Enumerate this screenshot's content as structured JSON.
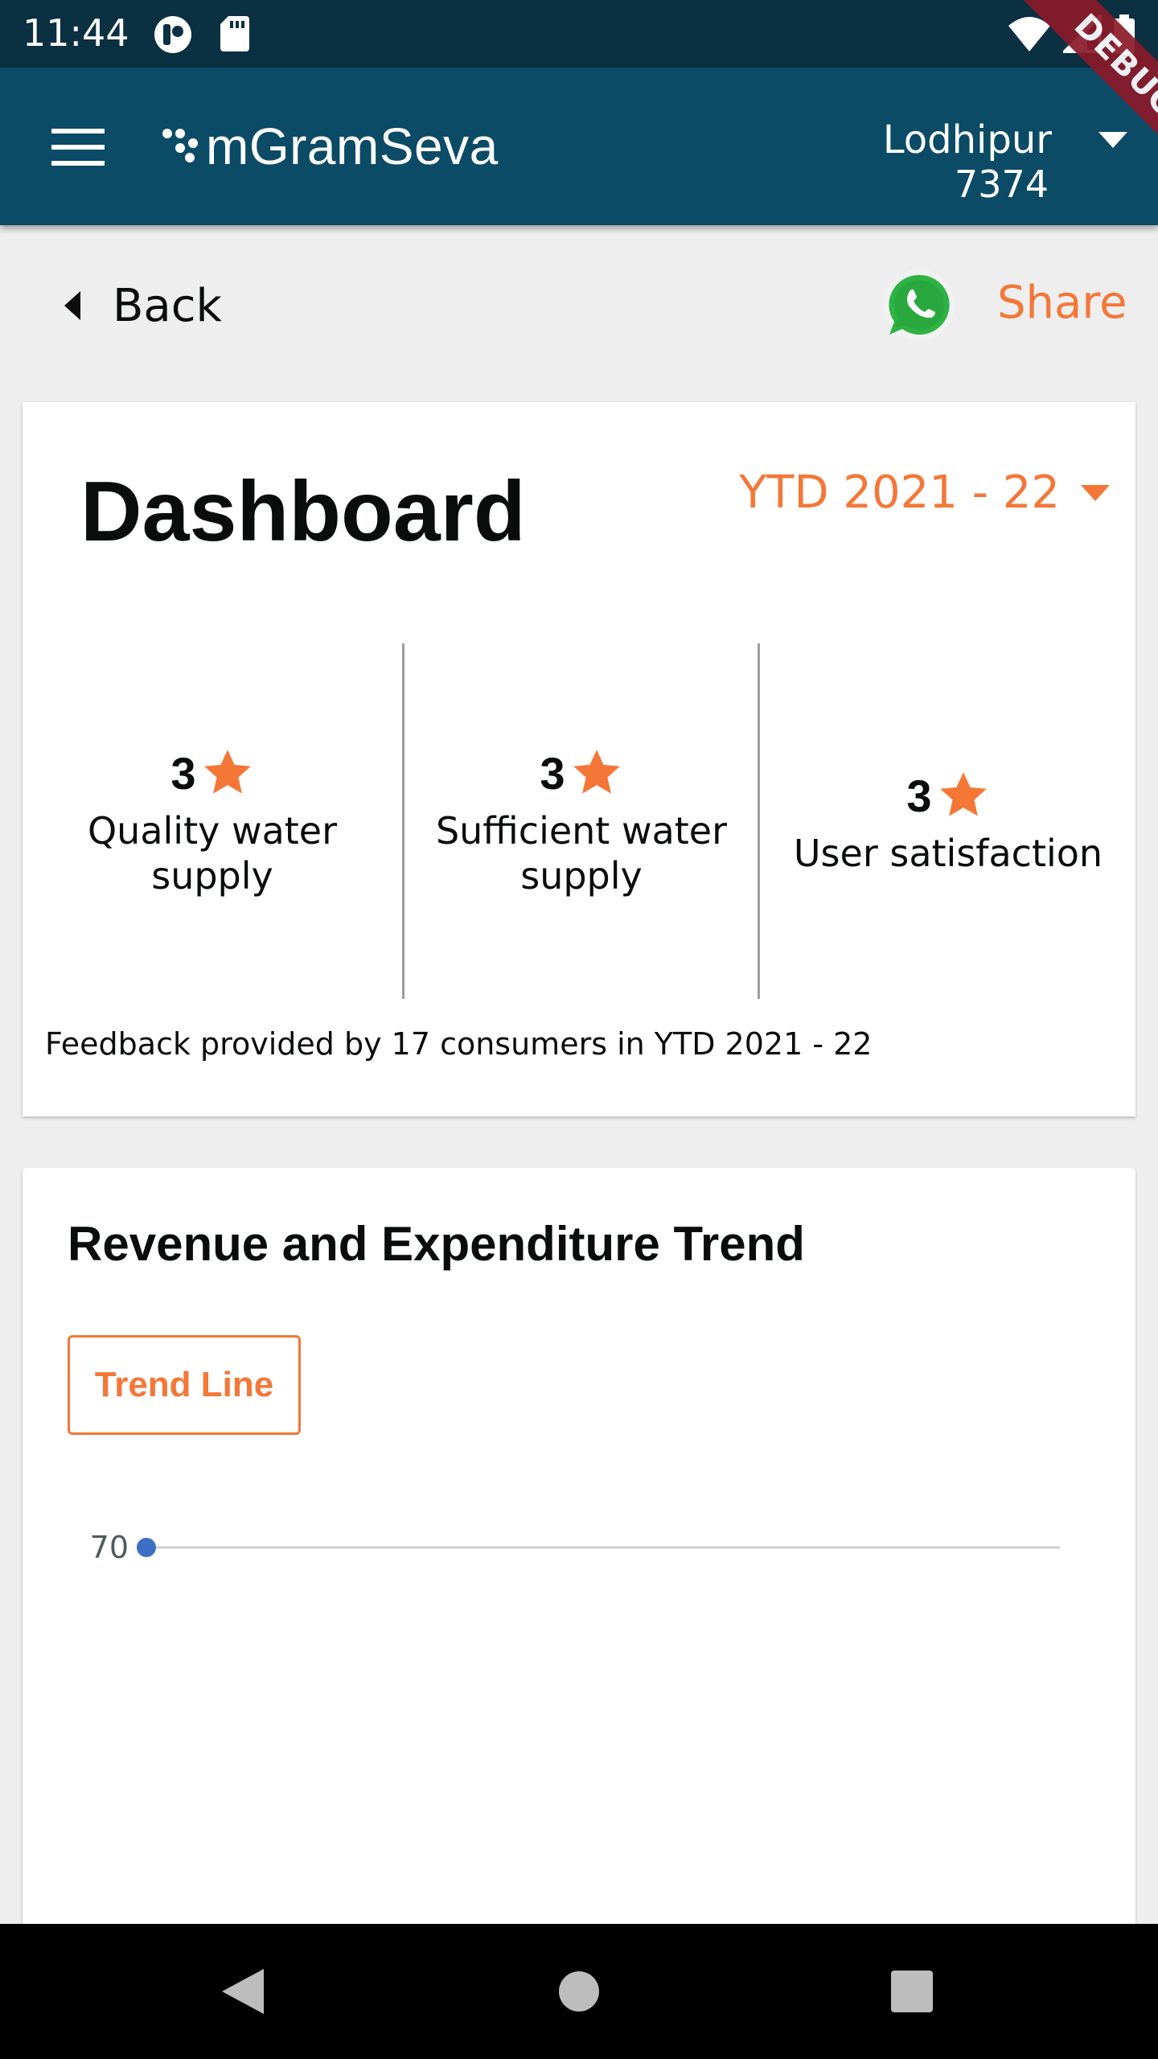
{
  "status_bar": {
    "time": "11:44",
    "icons": [
      "record-icon",
      "sd-card-icon",
      "wifi-icon",
      "signal-icon",
      "battery-icon"
    ],
    "background": "#0a3042"
  },
  "debug_banner": "DEBUG",
  "app_bar": {
    "logo_text": "mGramSeva",
    "location_name": "Lodhipur",
    "location_code": "7374",
    "background": "#0b4b66"
  },
  "nav_row": {
    "back_label": "Back",
    "share_label": "Share"
  },
  "dashboard": {
    "title": "Dashboard",
    "period": "YTD 2021 - 22",
    "ratings": [
      {
        "score": "3",
        "label": "Quality water supply"
      },
      {
        "score": "3",
        "label": "Sufficient water supply"
      },
      {
        "score": "3",
        "label": "User satisfaction"
      }
    ],
    "feedback_note": "Feedback provided by 17 consumers in YTD 2021 - 22"
  },
  "trend": {
    "title": "Revenue and Expenditure Trend",
    "toggle_label": "Trend Line"
  },
  "chart_data": {
    "type": "line",
    "title": "",
    "xlabel": "",
    "ylabel": "",
    "y_ticks": [
      "70"
    ],
    "series": [
      {
        "values": [
          70
        ],
        "color": "#3c6fc4"
      }
    ],
    "grid": true
  },
  "colors": {
    "accent": "#f47738",
    "text": "#0b0c0c",
    "page_background": "#eeeeee",
    "divider": "#9e9e9e",
    "star": "#f47738",
    "debug": "#8b1a2b"
  }
}
